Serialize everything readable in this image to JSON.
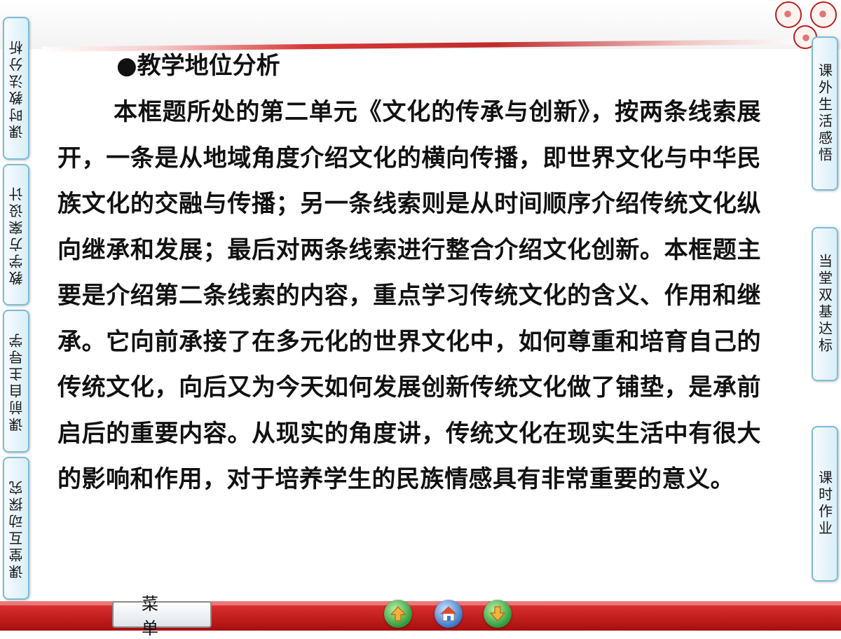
{
  "left_nav": [
    {
      "label": "课时教法分析"
    },
    {
      "label": "教学方案设计"
    },
    {
      "label": "课前自主导学"
    },
    {
      "label": "课堂互动探究"
    }
  ],
  "right_nav": [
    {
      "label": "课外生活感悟"
    },
    {
      "label": "当堂双基达标"
    },
    {
      "label": "课时作业"
    }
  ],
  "main": {
    "heading": "●教学地位分析",
    "paragraph": "本框题所处的第二单元《文化的传承与创新》，按两条线索展开，一条是从地域角度介绍文化的横向传播，即世界文化与中华民族文化的交融与传播；另一条线索则是从时间顺序介绍传统文化纵向继承和发展；最后对两条线索进行整合介绍文化创新。本框题主要是介绍第二条线索的内容，重点学习传统文化的含义、作用和继承。它向前承接了在多元化的世界文化中，如何尊重和培育自己的传统文化，向后又为今天如何发展创新传统文化做了铺垫，是承前启后的重要内容。从现实的角度讲，传统文化在现实生活中有很大的影响和作用，对于培养学生的民族情感具有非常重要的意义。"
  },
  "bottom_bar": {
    "menu_label": "菜单",
    "nav_icons": [
      "up-arrow-icon",
      "home-icon",
      "down-arrow-icon"
    ]
  },
  "logos": [
    "seal-logo",
    "seal-logo",
    "seal-logo"
  ],
  "colors": {
    "bar_red": "#c41a1a",
    "tab_border": "#7bbcd8",
    "nav_green": "#2e9b3a",
    "nav_blue": "#3a78c8"
  }
}
